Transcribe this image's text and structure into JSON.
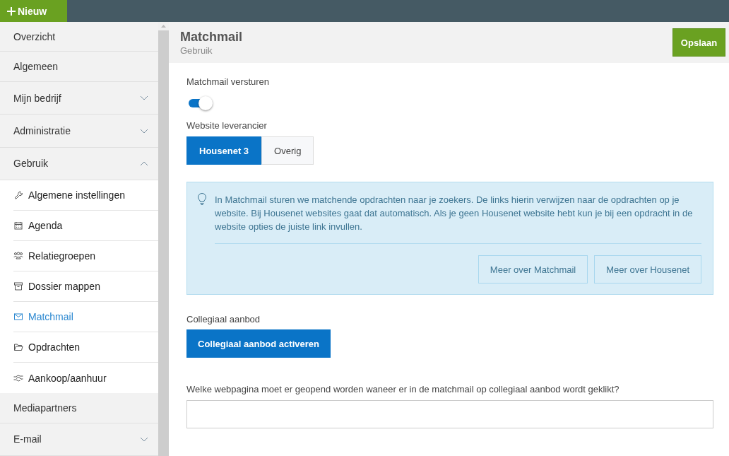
{
  "topbar": {
    "new_button": "Nieuw"
  },
  "sidebar": {
    "items": [
      {
        "kind": "link",
        "label": "Overzicht"
      },
      {
        "kind": "link",
        "label": "Algemeen"
      },
      {
        "kind": "group",
        "label": "Mijn bedrijf",
        "expanded": false
      },
      {
        "kind": "group",
        "label": "Administratie",
        "expanded": false
      },
      {
        "kind": "group",
        "label": "Gebruik",
        "expanded": true,
        "children": [
          {
            "label": "Algemene instellingen",
            "selected": false
          },
          {
            "label": "Agenda",
            "selected": false
          },
          {
            "label": "Relatiegroepen",
            "selected": false
          },
          {
            "label": "Dossier mappen",
            "selected": false
          },
          {
            "label": "Matchmail",
            "selected": true
          },
          {
            "label": "Opdrachten",
            "selected": false
          },
          {
            "label": "Aankoop/aanhuur",
            "selected": false
          }
        ]
      },
      {
        "kind": "link",
        "label": "Mediapartners"
      },
      {
        "kind": "group",
        "label": "E-mail",
        "expanded": false
      }
    ]
  },
  "header": {
    "title": "Matchmail",
    "subtitle": "Gebruik",
    "save_button": "Opslaan"
  },
  "form": {
    "send_toggle": {
      "label": "Matchmail versturen",
      "on": true
    },
    "supplier": {
      "label": "Website leverancier",
      "options": [
        {
          "label": "Housenet 3",
          "selected": true
        },
        {
          "label": "Overig",
          "selected": false
        }
      ]
    },
    "info": {
      "text": "In Matchmail sturen we matchende opdrachten naar je zoekers. De links hierin verwijzen naar de opdrachten op je website. Bij Housenet websites gaat dat automatisch. Als je geen Housenet website hebt kun je bij een opdracht in de website opties de juiste link invullen.",
      "buttons": [
        "Meer over Matchmail",
        "Meer over Housenet"
      ]
    },
    "collegial": {
      "label": "Collegiaal aanbod",
      "button": "Collegiaal aanbod activeren"
    },
    "url_field": {
      "label": "Welke webpagina moet er geopend worden waneer er in de matchmail op collegiaal aanbod wordt geklikt?"
    }
  }
}
